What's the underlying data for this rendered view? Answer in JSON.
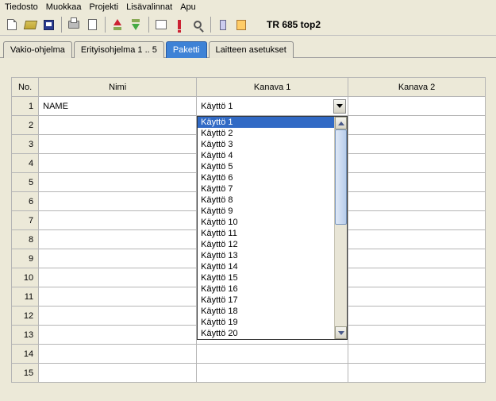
{
  "menu": [
    "Tiedosto",
    "Muokkaa",
    "Projekti",
    "Lisävalinnat",
    "Apu"
  ],
  "toolbar_title": "TR 685 top2",
  "tabs": [
    {
      "label": "Vakio-ohjelma",
      "active": false
    },
    {
      "label": "Erityisohjelma 1 .. 5",
      "active": false
    },
    {
      "label": "Paketti",
      "active": true
    },
    {
      "label": "Laitteen asetukset",
      "active": false
    }
  ],
  "columns": {
    "no": "No.",
    "name": "Nimi",
    "k1": "Kanava 1",
    "k2": "Kanava 2"
  },
  "row1": {
    "name": "NAME",
    "k1": "Käyttö 1"
  },
  "row_count": 15,
  "dropdown": {
    "items": [
      "Käyttö 1",
      "Käyttö 2",
      "Käyttö 3",
      "Käyttö 4",
      "Käyttö 5",
      "Käyttö 6",
      "Käyttö 7",
      "Käyttö 8",
      "Käyttö 9",
      "Käyttö 10",
      "Käyttö 11",
      "Käyttö 12",
      "Käyttö 13",
      "Käyttö 14",
      "Käyttö 15",
      "Käyttö 16",
      "Käyttö 17",
      "Käyttö 18",
      "Käyttö 19",
      "Käyttö 20"
    ],
    "selected_index": 0
  }
}
